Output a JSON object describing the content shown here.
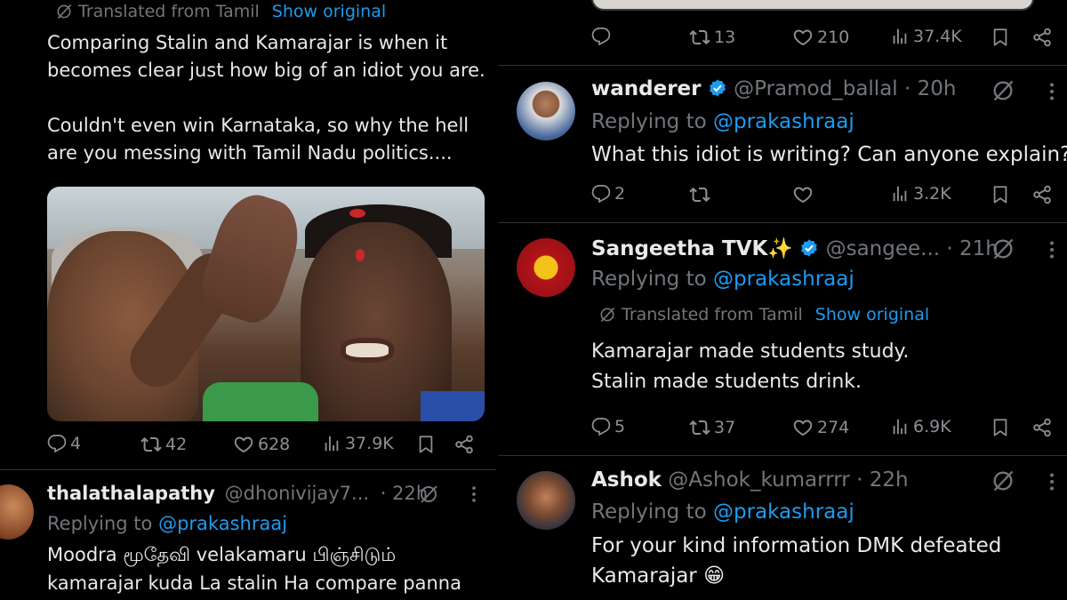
{
  "left_tweet": {
    "translated_label": "Translated from Tamil",
    "show_original": "Show original",
    "text_line1": "Comparing Stalin and Kamarajar is when it",
    "text_line2": "becomes clear just how big of an idiot you are.",
    "text_line3": "Couldn't even win Karnataka, so why the hell",
    "text_line4": "are you messing with Tamil Nadu politics....",
    "replies": "4",
    "retweets": "42",
    "likes": "628",
    "views": "37.9K"
  },
  "left_reply": {
    "name": "thalathalapathy",
    "handle": "@dhonivijay7...",
    "time": "· 22h",
    "replying_prefix": "Replying to",
    "replying_to": "@prakashraaj",
    "text_line1": "Moodra மூதேவி velakamaru பிஞ்சிடும்",
    "text_line2": "kamarajar kuda La stalin Ha compare panna"
  },
  "right_top_actions": {
    "replies": "",
    "retweets": "13",
    "likes": "210",
    "views": "37.4K"
  },
  "reply_wanderer": {
    "name": "wanderer",
    "handle": "@Pramod_ballal",
    "time": "· 20h",
    "replying_prefix": "Replying to",
    "replying_to": "@prakashraaj",
    "text": "What this idiot is writing? Can anyone explain?",
    "replies": "2",
    "retweets": "",
    "likes": "",
    "views": "3.2K"
  },
  "reply_sangeetha": {
    "name": "Sangeetha TVK✨",
    "handle": "@sangee...",
    "time": "· 21h",
    "replying_prefix": "Replying to",
    "replying_to": "@prakashraaj",
    "translated_label": "Translated from Tamil",
    "show_original": "Show original",
    "text_line1": "Kamarajar made students study.",
    "text_line2": "Stalin made students drink.",
    "replies": "5",
    "retweets": "37",
    "likes": "274",
    "views": "6.9K"
  },
  "reply_ashok": {
    "name": "Ashok",
    "handle": "@Ashok_kumarrrr",
    "time": "· 22h",
    "replying_prefix": "Replying to",
    "replying_to": "@prakashraaj",
    "text_line1": "For your kind information DMK defeated",
    "text_line2": "Kamarajar 😁"
  },
  "colors": {
    "background": "#000000",
    "text": "#e7e9ea",
    "muted": "#71767b",
    "link": "#1d9bf0",
    "verified": "#1d9bf0",
    "divider": "#2f3336"
  },
  "icons": [
    "translate-icon",
    "reply-icon",
    "retweet-icon",
    "like-icon",
    "views-icon",
    "bookmark-icon",
    "share-icon",
    "grok-icon",
    "more-icon",
    "verified-icon"
  ]
}
